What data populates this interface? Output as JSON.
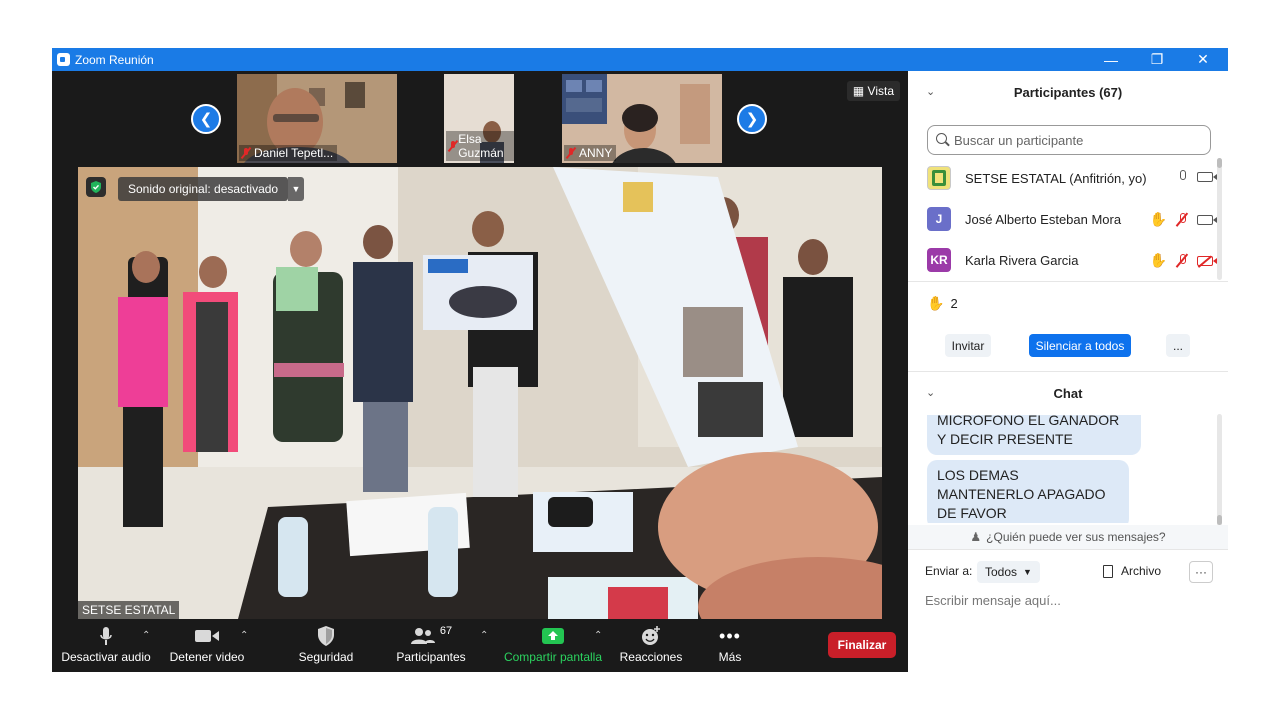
{
  "window": {
    "title": "Zoom Reunión",
    "accent": "#1a7be6"
  },
  "video": {
    "view_label": "Vista",
    "thumbnails": [
      {
        "name": "Daniel Tepetl..."
      },
      {
        "name": "Elsa Guzmán"
      },
      {
        "name": "ANNY"
      }
    ],
    "sound_original": "Sonido original: desactivado",
    "speaker_name": "SETSE ESTATAL"
  },
  "toolbar": {
    "mute": "Desactivar audio",
    "stop_video": "Detener video",
    "security": "Seguridad",
    "participants": "Participantes",
    "participants_count": "67",
    "share": "Compartir pantalla",
    "reactions": "Reacciones",
    "more": "Más",
    "end": "Finalizar"
  },
  "participants_panel": {
    "title": "Participantes (67)",
    "search_placeholder": "Buscar un participante",
    "list": [
      {
        "name": "SETSE ESTATAL (Anfitrión, yo)",
        "initials": "",
        "avatar_color": "#f0e27a",
        "hand": false,
        "mic": "on",
        "video": "on"
      },
      {
        "name": "José Alberto Esteban Mora",
        "initials": "J",
        "avatar_color": "#6a6fc9",
        "hand": true,
        "mic": "off",
        "video": "on"
      },
      {
        "name": "Karla Rivera Garcia",
        "initials": "KR",
        "avatar_color": "#9b3aa8",
        "hand": true,
        "mic": "off",
        "video": "off"
      }
    ],
    "raised_hands": "2",
    "invite": "Invitar",
    "mute_all": "Silenciar a todos",
    "more": "..."
  },
  "chat": {
    "title": "Chat",
    "messages": [
      {
        "text": "MICRÓFONO EL GANADOR Y DECIR PRESENTE"
      },
      {
        "text": "LOS DEMAS MANTENERLO APAGADO DE FAVOR"
      }
    ],
    "who_can_see": "¿Quién puede ver sus mensajes?",
    "send_to_label": "Enviar a:",
    "send_to_value": "Todos",
    "file_label": "Archivo",
    "more": "···",
    "input_placeholder": "Escribir mensaje aquí..."
  }
}
